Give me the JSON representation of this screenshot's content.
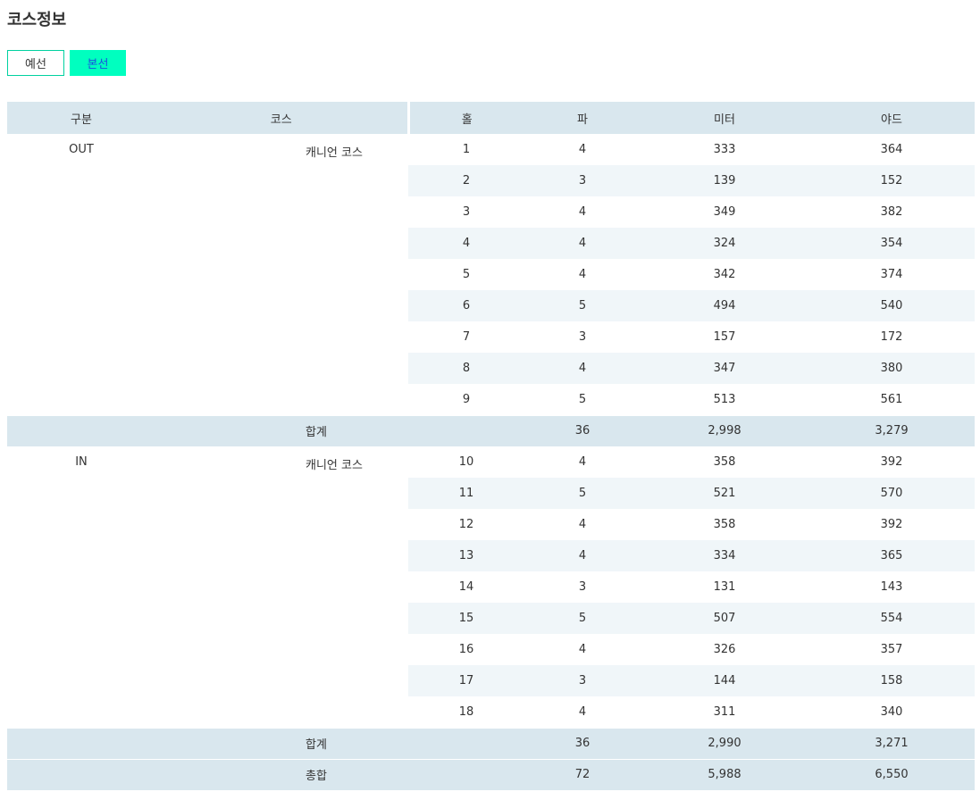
{
  "page": {
    "title": "코스정보"
  },
  "tabs": [
    {
      "label": "예선",
      "active": false
    },
    {
      "label": "본선",
      "active": true
    }
  ],
  "colors": {
    "accent": "#00ffbf",
    "header_bg": "#d9e7ee",
    "row_alt": "#f0f6f9",
    "active_text": "#1a4fe0"
  },
  "table": {
    "headers": [
      "구분",
      "코스",
      "홀",
      "파",
      "미터",
      "야드"
    ],
    "sections": [
      {
        "group": "OUT",
        "course": "캐니언 코스",
        "rows": [
          {
            "hole": "1",
            "par": "4",
            "meter": "333",
            "yard": "364"
          },
          {
            "hole": "2",
            "par": "3",
            "meter": "139",
            "yard": "152"
          },
          {
            "hole": "3",
            "par": "4",
            "meter": "349",
            "yard": "382"
          },
          {
            "hole": "4",
            "par": "4",
            "meter": "324",
            "yard": "354"
          },
          {
            "hole": "5",
            "par": "4",
            "meter": "342",
            "yard": "374"
          },
          {
            "hole": "6",
            "par": "5",
            "meter": "494",
            "yard": "540"
          },
          {
            "hole": "7",
            "par": "3",
            "meter": "157",
            "yard": "172"
          },
          {
            "hole": "8",
            "par": "4",
            "meter": "347",
            "yard": "380"
          },
          {
            "hole": "9",
            "par": "5",
            "meter": "513",
            "yard": "561"
          }
        ],
        "subtotal": {
          "label": "합계",
          "par": "36",
          "meter": "2,998",
          "yard": "3,279"
        }
      },
      {
        "group": "IN",
        "course": "캐니언 코스",
        "rows": [
          {
            "hole": "10",
            "par": "4",
            "meter": "358",
            "yard": "392"
          },
          {
            "hole": "11",
            "par": "5",
            "meter": "521",
            "yard": "570"
          },
          {
            "hole": "12",
            "par": "4",
            "meter": "358",
            "yard": "392"
          },
          {
            "hole": "13",
            "par": "4",
            "meter": "334",
            "yard": "365"
          },
          {
            "hole": "14",
            "par": "3",
            "meter": "131",
            "yard": "143"
          },
          {
            "hole": "15",
            "par": "5",
            "meter": "507",
            "yard": "554"
          },
          {
            "hole": "16",
            "par": "4",
            "meter": "326",
            "yard": "357"
          },
          {
            "hole": "17",
            "par": "3",
            "meter": "144",
            "yard": "158"
          },
          {
            "hole": "18",
            "par": "4",
            "meter": "311",
            "yard": "340"
          }
        ],
        "subtotal": {
          "label": "합계",
          "par": "36",
          "meter": "2,990",
          "yard": "3,271"
        }
      }
    ],
    "total": {
      "label": "총합",
      "par": "72",
      "meter": "5,988",
      "yard": "6,550"
    }
  }
}
